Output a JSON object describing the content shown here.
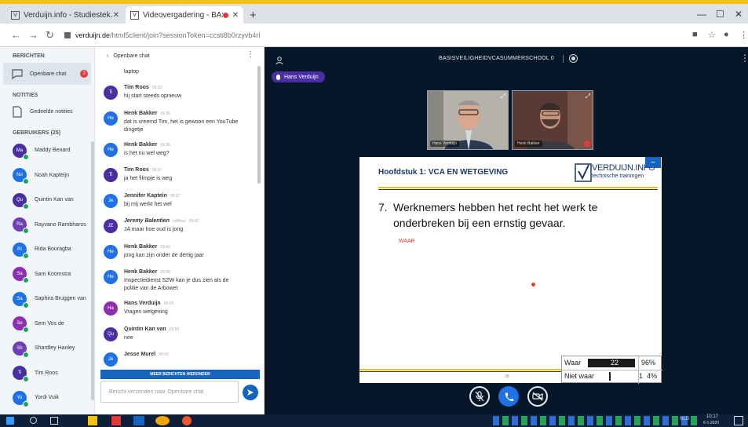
{
  "browser": {
    "tabs": [
      {
        "title": "Verduijn.info - Studiestek.nl - Bo",
        "favicon": "V",
        "active": false
      },
      {
        "title": "Videovergadering - BASISVE",
        "favicon": "V",
        "active": true
      }
    ],
    "new_tab": "+",
    "url_host": "verduijn.de",
    "url_path": "/html5client/join?sessionToken=ccsti8b0rzyvb4rl"
  },
  "sidebar": {
    "messages_heading": "BERICHTEN",
    "public_chat": {
      "label": "Openbare chat",
      "badge": "3"
    },
    "notes_heading": "NOTITIES",
    "shared_notes": {
      "label": "Gedeelde notities"
    },
    "users_heading": "GEBRUIKERS (25)",
    "users": [
      {
        "initials": "Ma",
        "name": "Maddy Benard",
        "color": "#4a2fa3"
      },
      {
        "initials": "No",
        "name": "Noah Kapteijn",
        "color": "#1e72e6"
      },
      {
        "initials": "Qu",
        "name": "Quintin Kan van",
        "color": "#4a2fa3"
      },
      {
        "initials": "Ra",
        "name": "Rayvano Rambharos",
        "color": "#6f3fb5"
      },
      {
        "initials": "Ri",
        "name": "Rida Bouragba",
        "color": "#1e72e6"
      },
      {
        "initials": "Sa",
        "name": "Sam Koomstra",
        "color": "#8e2fb0"
      },
      {
        "initials": "Sa",
        "name": "Saphira Bruggen van",
        "color": "#1e72e6"
      },
      {
        "initials": "Se",
        "name": "Sem Vos de",
        "color": "#8e2fb0"
      },
      {
        "initials": "Sh",
        "name": "Shardley Hanley",
        "color": "#6f3fb5"
      },
      {
        "initials": "Ti",
        "name": "Tim Roos",
        "color": "#4a2fa3"
      },
      {
        "initials": "Yo",
        "name": "Yordi Vuik",
        "color": "#1e72e6"
      }
    ]
  },
  "chat": {
    "back_label": "Openbare chat",
    "top_fragment": "laptop",
    "messages": [
      {
        "initials": "Ti",
        "name": "Tim Roos",
        "time": "09:33",
        "lines": [
          "hij start steeds opnieuw"
        ],
        "color": "#4a2fa3"
      },
      {
        "initials": "He",
        "name": "Henk Bakker",
        "time": "09:36",
        "lines": [
          "dat is vreemd Tim, het is gewoon een YouTube",
          "dingetje"
        ],
        "color": "#1e72e6"
      },
      {
        "initials": "He",
        "name": "Henk Bakker",
        "time": "09:36",
        "lines": [
          "is het nu wel weg?"
        ],
        "color": "#1e72e6"
      },
      {
        "initials": "Ti",
        "name": "Tim Roos",
        "time": "09:37",
        "lines": [
          "ja het filmpje is weg"
        ],
        "color": "#4a2fa3"
      },
      {
        "initials": "Je",
        "name": "Jennifer Kaptein",
        "time": "09:37",
        "lines": [
          "bij mij werkt het wel"
        ],
        "color": "#1e72e6"
      },
      {
        "initials": "JE",
        "name": "Jeremy Balentien",
        "time": "09:42",
        "offline": "(offline)",
        "italic": true,
        "lines": [
          "JA maar hoe oud is jong"
        ],
        "color": "#4a2fa3"
      },
      {
        "initials": "He",
        "name": "Henk Bakker",
        "time": "09:42",
        "lines": [
          "jong kan zijn onder de dertig jaar"
        ],
        "color": "#1e72e6"
      },
      {
        "initials": "He",
        "name": "Henk Bakker",
        "time": "09:58",
        "lines": [
          "Inspectiedienst SZW kan je dus zien als de",
          "politie van de Arbowet"
        ],
        "color": "#1e72e6"
      },
      {
        "initials": "Ha",
        "name": "Hans Verduijn",
        "time": "09:59",
        "lines": [
          "Vragen wetgeving"
        ],
        "color": "#8e2fb0"
      },
      {
        "initials": "Qu",
        "name": "Quintin Kan van",
        "time": "09:59",
        "lines": [
          "nee"
        ],
        "color": "#4a2fa3"
      },
      {
        "initials": "Je",
        "name": "Jesse Murel",
        "time": "09:59",
        "lines": [
          ""
        ],
        "color": "#1e72e6"
      }
    ],
    "more_messages_label": "MEER BERICHTEN HIERONDER",
    "input_placeholder": "Bericht verzenden naar Openbare chat"
  },
  "stage": {
    "meeting_title": "BASISVEILIGHEIDVCASUMMERSCHOOL 0",
    "talking_indicator": "Hans Verduijn",
    "videos": [
      {
        "name": "Hans Verduijn",
        "muted": false
      },
      {
        "name": "Henk Bakker",
        "muted": true
      }
    ],
    "slide": {
      "title": "Hoofdstuk 1: VCA EN WETGEVING",
      "logo_name": "VERDUIJN.INFO",
      "logo_sub": "technische trainingen",
      "question_number": "7.",
      "question_text": "Werknemers hebben het recht het werk te onderbreken bij een ernstig gevaar.",
      "answer": "WAAR",
      "page": "28"
    },
    "poll": [
      {
        "label": "Waar",
        "count": "22",
        "percent": "96%",
        "fraction": 0.96
      },
      {
        "label": "Niet waar",
        "count": "1",
        "percent": "4%",
        "fraction": 0.04
      }
    ]
  },
  "taskbar": {
    "language": "NLD",
    "time": "10:17",
    "date": "6-1-2020"
  },
  "colors": {
    "stage_bg": "#06172a",
    "accent_blue": "#1565c0",
    "slide_navy": "#1a3869",
    "slide_yellow": "#f2c100",
    "alert_red": "#e53935",
    "online_green": "#12a85e"
  }
}
